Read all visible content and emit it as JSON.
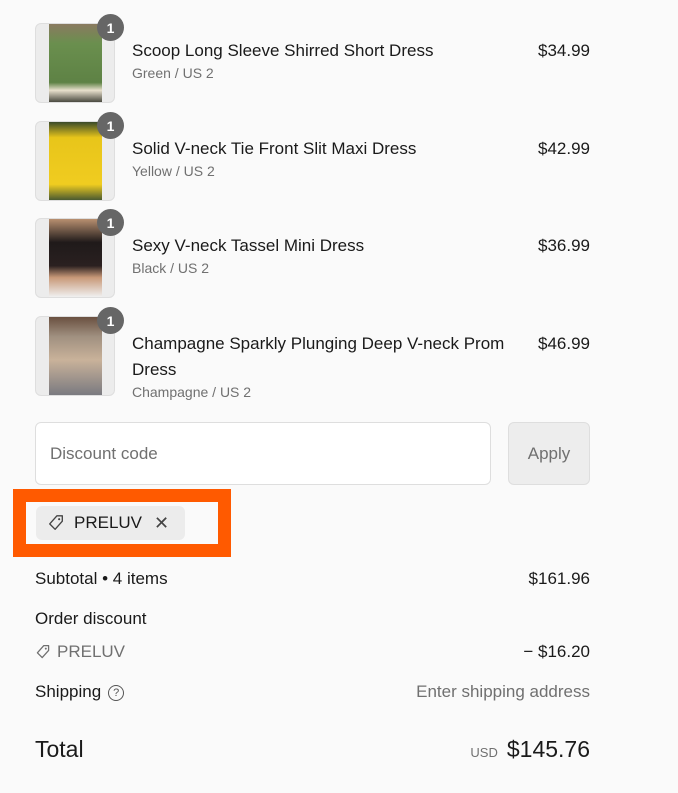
{
  "items": [
    {
      "title": "Scoop Long Sleeve Shirred Short Dress",
      "variant": "Green / US 2",
      "price": "$34.99",
      "quantity": "1",
      "image_color": "#6a8f4e"
    },
    {
      "title": "Solid V-neck Tie Front Slit Maxi Dress",
      "variant": "Yellow / US 2",
      "price": "$42.99",
      "quantity": "1",
      "image_color": "#e8c51a"
    },
    {
      "title": "Sexy V-neck Tassel Mini Dress",
      "variant": "Black / US 2",
      "price": "$36.99",
      "quantity": "1",
      "image_color": "#1f1a1a"
    },
    {
      "title": "Champagne Sparkly Plunging Deep V-neck Prom Dress",
      "variant": "Champagne / US 2",
      "price": "$46.99",
      "quantity": "1",
      "image_color": "#c9b29a"
    }
  ],
  "discount": {
    "placeholder": "Discount code",
    "apply_label": "Apply",
    "applied_code": "PRELUV",
    "highlight_color": "#ff5a00"
  },
  "summary": {
    "subtotal_label": "Subtotal • 4 items",
    "subtotal_value": "$161.96",
    "order_discount_label": "Order discount",
    "discount_code": "PRELUV",
    "discount_value": "− $16.20",
    "shipping_label": "Shipping",
    "shipping_value": "Enter shipping address",
    "total_label": "Total",
    "currency": "USD",
    "total_value": "$145.76"
  }
}
